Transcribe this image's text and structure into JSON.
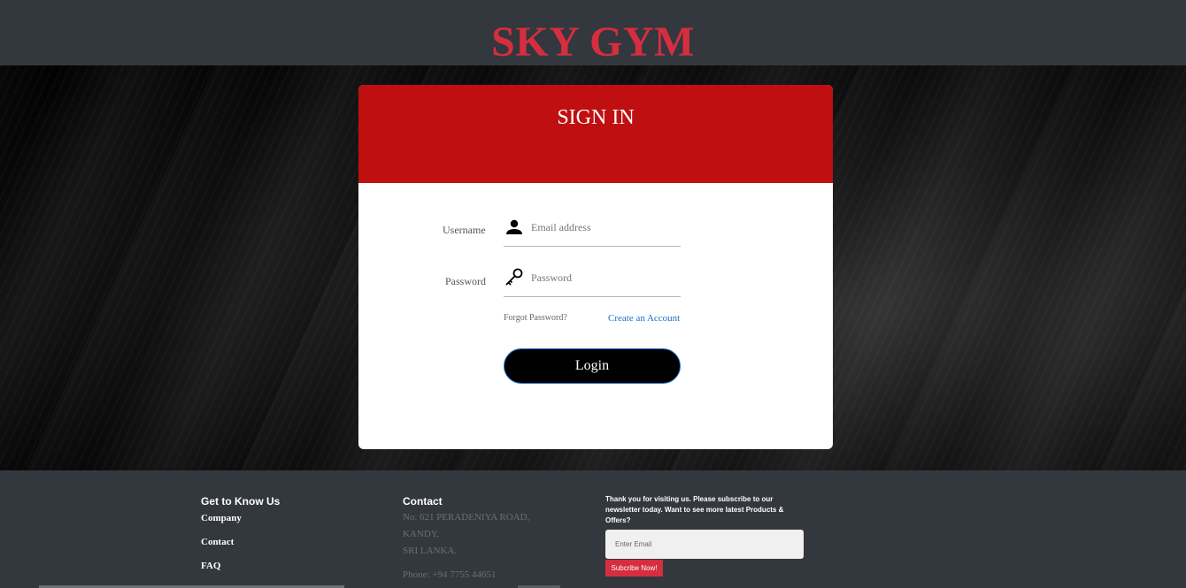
{
  "brand": {
    "title": "SKY GYM",
    "color": "#d42e3f"
  },
  "signin": {
    "title": "SIGN IN",
    "header_color": "#c00f10",
    "username_label": "Username",
    "username_placeholder": "Email address",
    "username_icon": "user-icon",
    "password_label": "Password",
    "password_placeholder": "Password",
    "password_icon": "key-icon",
    "forgot_label": "Forgot Password?",
    "create_label": "Create an Account",
    "login_label": "Login"
  },
  "footer": {
    "col1": {
      "title": "Get to Know Us",
      "links": [
        "Company",
        "Contact",
        "FAQ"
      ]
    },
    "col2": {
      "title": "Contact",
      "address": [
        "No. 621 PERADENIYA ROAD,",
        "KANDY,",
        "SRI LANKA."
      ],
      "phone": "Phone: +94 7755 44651"
    },
    "newsletter": {
      "text": "Thank you for visiting us. Please subscribe to our newsletter today. Want to see more latest Products & Offers?",
      "email_placeholder": "Enter Email",
      "subscribe_label": "Subcribe Now!",
      "button_color": "#d42e3f"
    }
  }
}
